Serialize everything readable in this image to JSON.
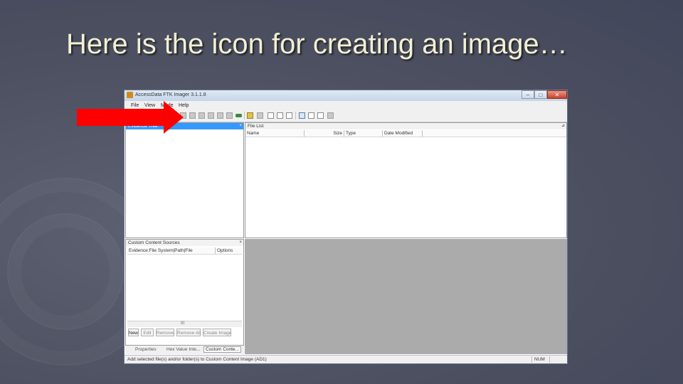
{
  "slide": {
    "title": "Here is the icon for creating an image…"
  },
  "window": {
    "title": "AccessData FTK Imager 3.1.1.8",
    "controls": {
      "minimize": "–",
      "maximize": "□",
      "close": "✕"
    }
  },
  "menu": [
    "File",
    "View",
    "Mode",
    "Help"
  ],
  "toolbar_icons": [
    "add-evidence-icon",
    "add-all-devices-icon",
    "remove-evidence-icon",
    "remove-all-icon",
    "create-image-icon",
    "export-disk-image-icon",
    "export-logical-image-icon",
    "image-mounting-icon",
    "decrypt-icon",
    "detect-efs-icon",
    "capture-memory-icon",
    "obtain-protected-files-icon",
    "export-files-icon",
    "export-file-hash-list-icon",
    "export-directory-listing-icon",
    "verify-drive-icon",
    "help-icon"
  ],
  "panes": {
    "evidence_tree": {
      "title": "Evidence Tree",
      "pin": "×"
    },
    "file_list": {
      "title": "File List",
      "pin": "⊿",
      "columns": [
        "Name",
        "Size",
        "Type",
        "Date Modified"
      ]
    },
    "custom_content": {
      "title": "Custom Content Sources",
      "pin": "×",
      "columns": [
        "Evidence:File System|Path|File",
        "Options"
      ],
      "scroll_marker": "III",
      "buttons": [
        "New",
        "Edit",
        "Remove",
        "Remove All",
        "Create Image"
      ],
      "tabs": [
        "Properties",
        "Hex Value Inte...",
        "Custom Conte..."
      ]
    }
  },
  "status": {
    "text": "Add selected file(s) and/or folder(s) to Custom Content Image (AD1)",
    "num": "NUM"
  },
  "colors": {
    "arrow": "#ff0000",
    "title_text": "#f2efd3",
    "selection": "#3399ff"
  }
}
